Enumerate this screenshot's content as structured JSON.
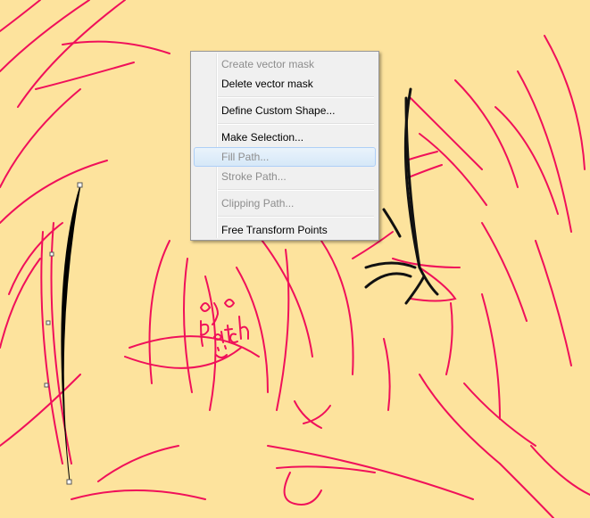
{
  "context_menu": {
    "items": [
      {
        "label": "Create vector mask",
        "enabled": false
      },
      {
        "label": "Delete vector mask",
        "enabled": true
      },
      {
        "label": "Define Custom Shape...",
        "enabled": true
      },
      {
        "label": "Make Selection...",
        "enabled": true
      },
      {
        "label": "Fill Path...",
        "enabled": false,
        "highlighted": true
      },
      {
        "label": "Stroke Path...",
        "enabled": false
      },
      {
        "label": "Clipping Path...",
        "enabled": false
      },
      {
        "label": "Free Transform Points",
        "enabled": true
      }
    ]
  },
  "canvas": {
    "background_color": "#fde39d",
    "line_color": "#f0105a",
    "handwritten_text": "eye patch :)"
  }
}
